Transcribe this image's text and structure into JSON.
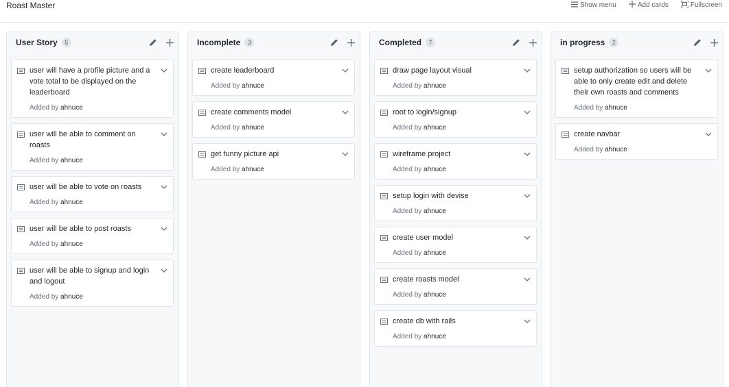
{
  "header": {
    "title": "Roast Master",
    "actions": [
      {
        "label": "Show menu",
        "icon": "menu-icon"
      },
      {
        "label": "Add cards",
        "icon": "plus-icon"
      },
      {
        "label": "Fullscreen",
        "icon": "fullscreen-icon"
      }
    ]
  },
  "colors": {
    "column_bg": "#f6f8fa",
    "border": "#e1e4e8",
    "muted_text": "#6a737d",
    "text": "#24292e"
  },
  "columns": [
    {
      "name": "User Story",
      "count": "5",
      "cards": [
        {
          "text": "user will have a profile picture and a vote total to be displayed on the leaderboard",
          "added_by_label": "Added by",
          "author": "ahnuce"
        },
        {
          "text": "user will be able to comment on roasts",
          "added_by_label": "Added by",
          "author": "ahnuce"
        },
        {
          "text": "user will be able to vote on roasts",
          "added_by_label": "Added by",
          "author": "ahnuce"
        },
        {
          "text": "user will be able to post roasts",
          "added_by_label": "Added by",
          "author": "ahnuce"
        },
        {
          "text": "user will be able to signup and login and logout",
          "added_by_label": "Added by",
          "author": "ahnuce"
        }
      ]
    },
    {
      "name": "Incomplete",
      "count": "3",
      "cards": [
        {
          "text": "create leaderboard",
          "added_by_label": "Added by",
          "author": "ahnuce"
        },
        {
          "text": "create comments model",
          "added_by_label": "Added by",
          "author": "ahnuce"
        },
        {
          "text": "get funny picture api",
          "added_by_label": "Added by",
          "author": "ahnuce"
        }
      ]
    },
    {
      "name": "Completed",
      "count": "7",
      "cards": [
        {
          "text": "draw page layout visual",
          "added_by_label": "Added by",
          "author": "ahnuce"
        },
        {
          "text": "root to login/signup",
          "added_by_label": "Added by",
          "author": "ahnuce"
        },
        {
          "text": "wireframe project",
          "added_by_label": "Added by",
          "author": "ahnuce"
        },
        {
          "text": "setup login with devise",
          "added_by_label": "Added by",
          "author": "ahnuce"
        },
        {
          "text": "create user model",
          "added_by_label": "Added by",
          "author": "ahnuce"
        },
        {
          "text": "create roasts model",
          "added_by_label": "Added by",
          "author": "ahnuce"
        },
        {
          "text": "create db with rails",
          "added_by_label": "Added by",
          "author": "ahnuce"
        }
      ]
    },
    {
      "name": "in progress",
      "count": "2",
      "cards": [
        {
          "text": "setup authorization so users will be able to only create edit and delete their own roasts and comments",
          "added_by_label": "Added by",
          "author": "ahnuce"
        },
        {
          "text": "create navbar",
          "added_by_label": "Added by",
          "author": "ahnuce"
        }
      ]
    }
  ]
}
